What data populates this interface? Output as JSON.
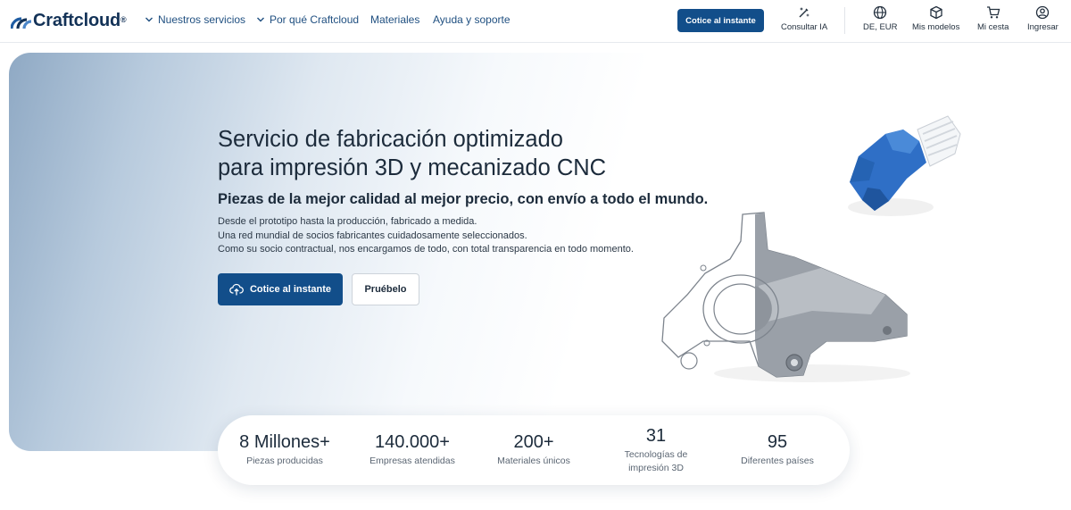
{
  "brand": {
    "name": "Craftcloud",
    "reg": "®"
  },
  "nav": {
    "items": [
      {
        "label": "Nuestros servicios",
        "has_dropdown": true
      },
      {
        "label": "Por qué Craftcloud",
        "has_dropdown": true
      },
      {
        "label": "Materiales",
        "has_dropdown": false
      },
      {
        "label": "Ayuda y soporte",
        "has_dropdown": false
      }
    ]
  },
  "header": {
    "cta_label": "Cotice al instante",
    "tools": {
      "ai": {
        "label": "Consultar IA",
        "icon": "ai-sparkle-icon"
      },
      "locale": {
        "label": "DE, EUR",
        "icon": "globe-icon"
      },
      "models": {
        "label": "Mis modelos",
        "icon": "cube-icon"
      },
      "cart": {
        "label": "Mi cesta",
        "icon": "cart-icon"
      },
      "login": {
        "label": "Ingresar",
        "icon": "user-icon"
      }
    }
  },
  "hero": {
    "title_line1": "Servicio de fabricación optimizado",
    "title_line2": "para impresión 3D y mecanizado CNC",
    "subtitle": "Piezas de la mejor calidad al mejor precio, con envío a todo el mundo.",
    "desc_line1": "Desde el prototipo hasta la producción, fabricado a medida.",
    "desc_line2": "Una red mundial de socios fabricantes cuidadosamente seleccionados.",
    "desc_line3": "Como su socio contractual, nos encargamos de todo, con total transparencia en todo momento.",
    "primary_label": "Cotice al instante",
    "secondary_label": "Pruébelo"
  },
  "stats": [
    {
      "value": "8 Millones+",
      "label": "Piezas producidas"
    },
    {
      "value": "140.000+",
      "label": "Empresas atendidas"
    },
    {
      "value": "200+",
      "label": "Materiales únicos"
    },
    {
      "value": "31",
      "label_line1": "Tecnologías de",
      "label_line2": "impresión 3D"
    },
    {
      "value": "95",
      "label": "Diferentes países"
    }
  ],
  "colors": {
    "primary": "#124e8a",
    "brand_dark": "#133257",
    "nav_text": "#1f4f80",
    "part_blue": "#2f6fc6"
  }
}
